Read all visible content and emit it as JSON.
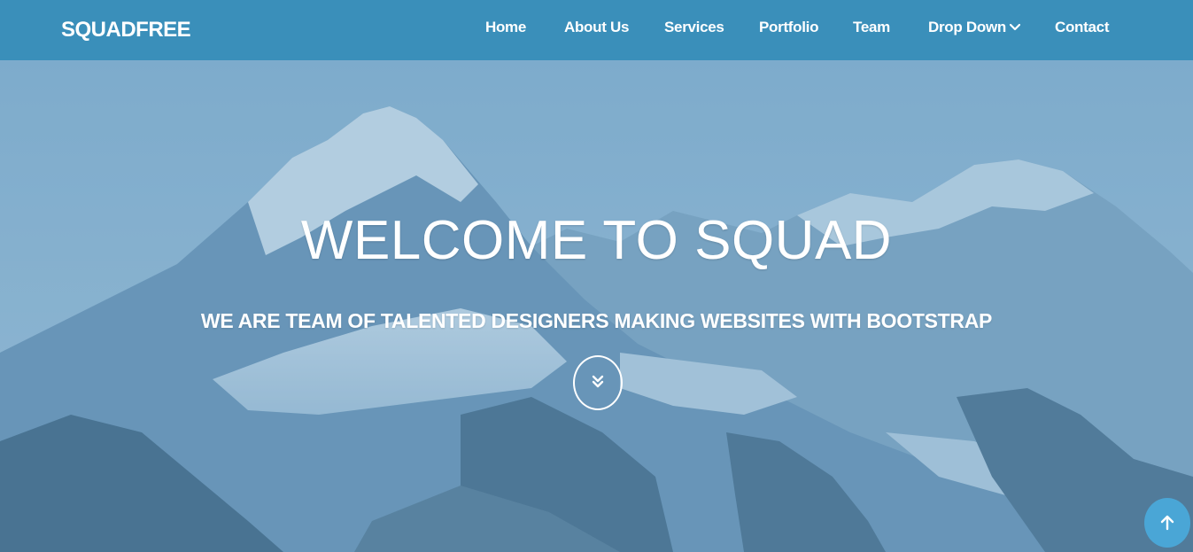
{
  "navbar": {
    "brand": "SQUADFREE",
    "items": [
      {
        "label": "Home"
      },
      {
        "label": "About Us"
      },
      {
        "label": "Services"
      },
      {
        "label": "Portfolio"
      },
      {
        "label": "Team"
      },
      {
        "label": "Drop Down",
        "icon": "chevron-down-icon"
      },
      {
        "label": "Contact"
      }
    ]
  },
  "hero": {
    "title": "WELCOME TO SQUAD",
    "subtitle": "WE ARE TEAM OF TALENTED DESIGNERS MAKING WEBSITES WITH BOOTSTRAP",
    "scroll_icon": "double-chevron-down-icon"
  },
  "back_to_top": {
    "icon": "arrow-up-icon"
  },
  "colors": {
    "navbar": "#3a8fba",
    "back_to_top": "#4aa6d6",
    "text": "#ffffff"
  }
}
